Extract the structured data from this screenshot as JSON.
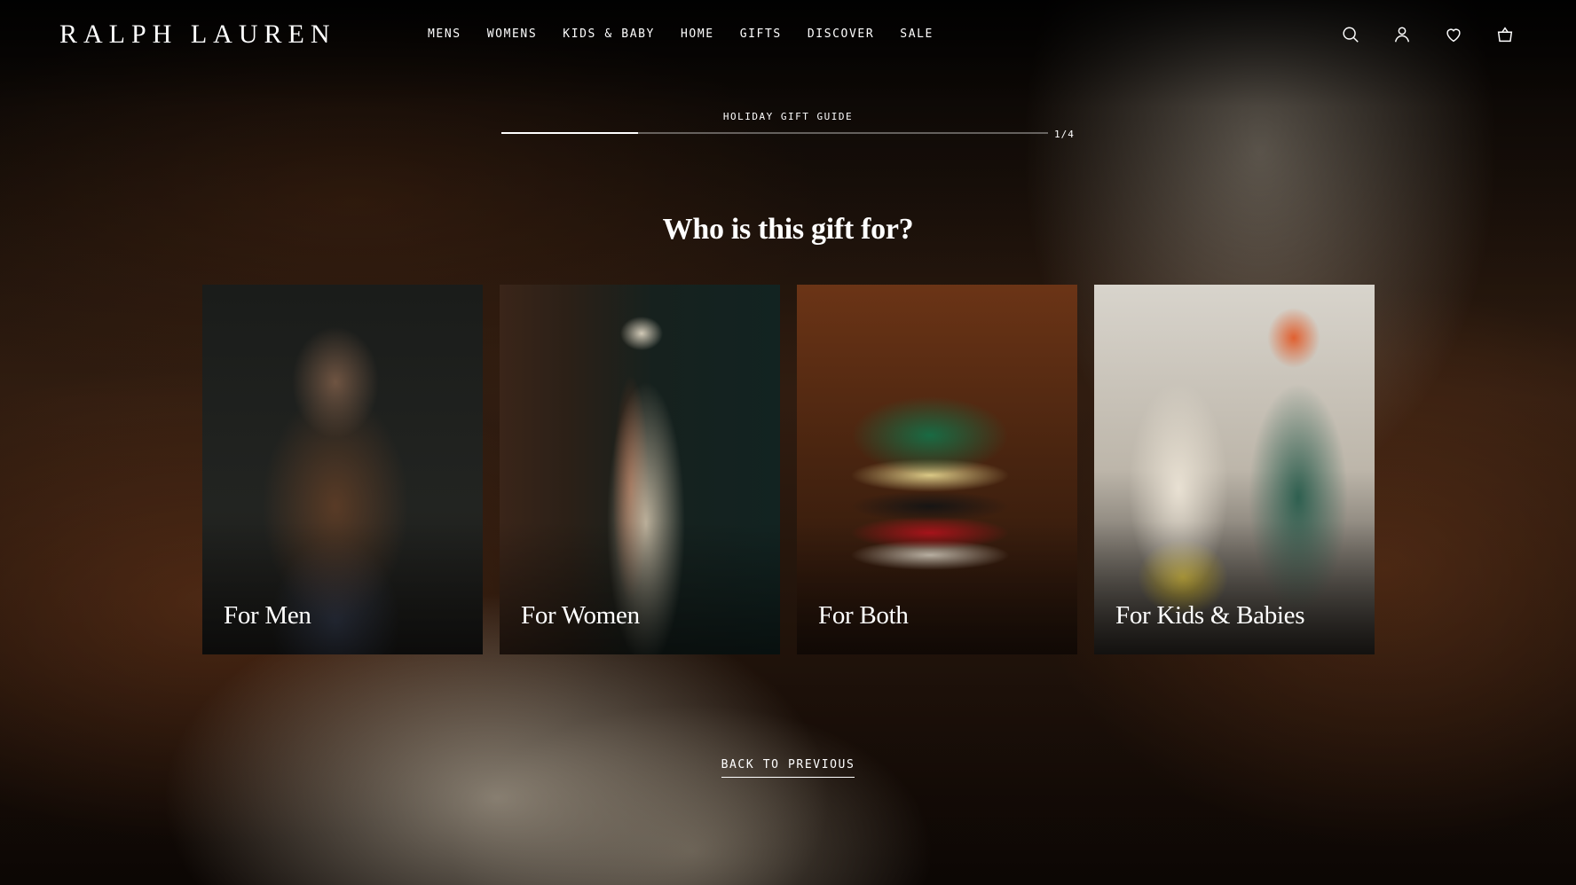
{
  "brand": {
    "name": "RALPH LAUREN"
  },
  "nav": {
    "items": [
      "MENS",
      "WOMENS",
      "KIDS & BABY",
      "HOME",
      "GIFTS",
      "DISCOVER",
      "SALE"
    ]
  },
  "header_icons": [
    "search-icon",
    "account-icon",
    "wishlist-icon",
    "shopping-bag-icon"
  ],
  "quiz": {
    "title": "HOLIDAY GIFT GUIDE",
    "step_label": "1/4",
    "progress_fraction": 0.25,
    "question": "Who is this gift for?",
    "options": [
      {
        "label": "For Men"
      },
      {
        "label": "For Women"
      },
      {
        "label": "For Both"
      },
      {
        "label": "For Kids & Babies"
      }
    ],
    "back_label": "BACK TO PREVIOUS"
  },
  "colors": {
    "text": "#ffffff",
    "background": "#120c08"
  }
}
